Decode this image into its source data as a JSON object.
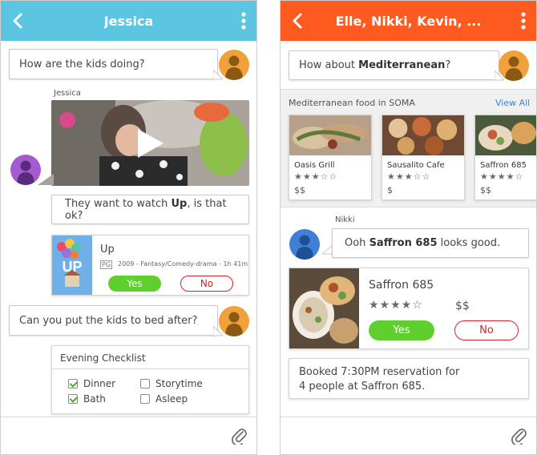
{
  "left_screen": {
    "title": "Jessica",
    "messages": {
      "kids_question": "How are the kids doing?",
      "jessica_label": "Jessica",
      "watch_prefix": "They want to watch ",
      "watch_bold": "Up",
      "watch_suffix": ", is that ok?",
      "bed_question": "Can you put the kids to bed after?"
    },
    "movie": {
      "title": "Up",
      "rating": "PG",
      "details": "2009 - Fantasy/Comedy-drama - 1h 41m",
      "yes_label": "Yes",
      "no_label": "No"
    },
    "checklist": {
      "title": "Evening Checklist",
      "items": [
        {
          "label": "Dinner",
          "checked": true
        },
        {
          "label": "Storytime",
          "checked": false
        },
        {
          "label": "Bath",
          "checked": true
        },
        {
          "label": "Asleep",
          "checked": false
        }
      ]
    }
  },
  "right_screen": {
    "title": "Elle, Nikki, Kevin, ...",
    "messages": {
      "question_prefix": "How about ",
      "question_bold": "Mediterranean",
      "question_suffix": "?",
      "nikki_label": "Nikki",
      "nikki_prefix": "Ooh ",
      "nikki_bold": "Saffron 685",
      "nikki_suffix": " looks good."
    },
    "results": {
      "header": "Mediterranean food in SOMA",
      "view_all": "View All",
      "restaurants": [
        {
          "name": "Oasis Grill",
          "stars": "★★★☆☆",
          "price": "$$"
        },
        {
          "name": "Sausalito Cafe",
          "stars": "★★★☆☆",
          "price": "$"
        },
        {
          "name": "Saffron 685",
          "stars": "★★★★☆",
          "price": "$$"
        }
      ]
    },
    "selected": {
      "name": "Saffron 685",
      "stars": "★★★★☆",
      "price": "$$",
      "yes_label": "Yes",
      "no_label": "No"
    },
    "booking": {
      "line1": "Booked 7:30PM reservation for",
      "line2": "4 people at Saffron 685."
    }
  },
  "colors": {
    "left_header": "#5bc5e2",
    "right_header": "#ff5a1f",
    "yes_green": "#5fcf2e",
    "no_red": "#d6202a",
    "avatar_orange": "#f0a13a",
    "avatar_purple": "#a45bd1",
    "avatar_blue": "#3f7fd6",
    "link_blue": "#3a86d4"
  },
  "icons": [
    "back-arrow-icon",
    "more-menu-icon",
    "paperclip-icon",
    "play-icon",
    "checkbox-icon",
    "star-icon"
  ]
}
